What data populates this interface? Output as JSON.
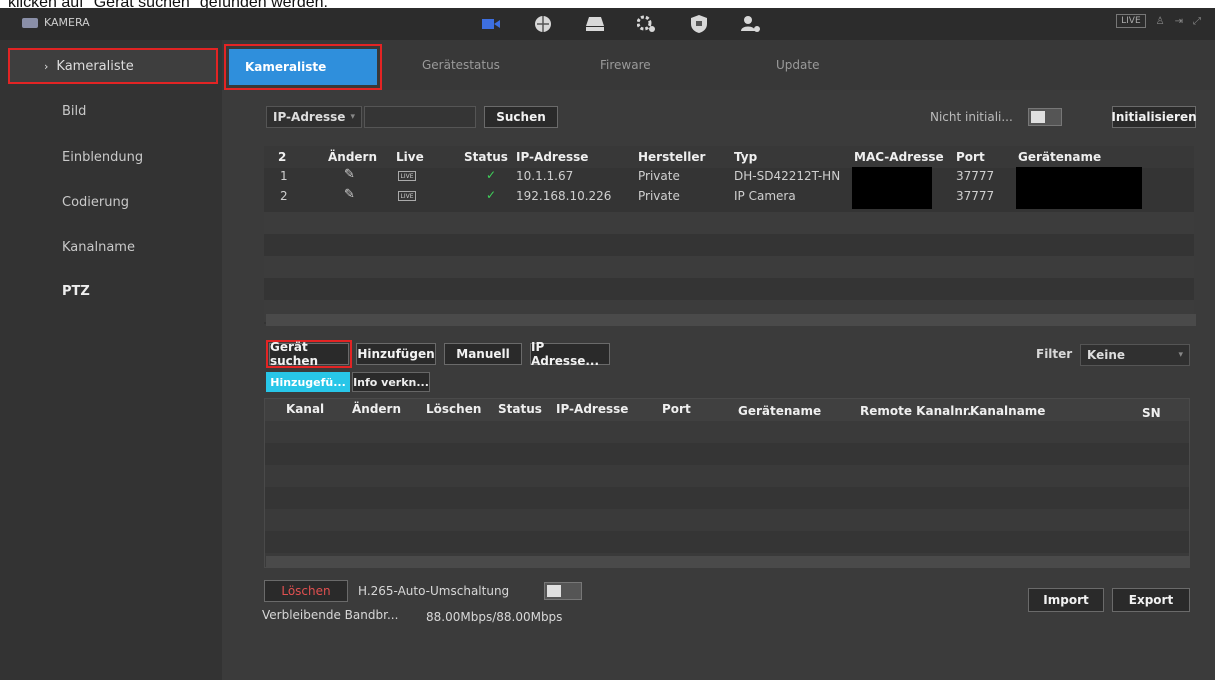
{
  "caption": "klicken auf \"Gerät suchen\" gefunden werden.",
  "app": {
    "title": "KAMERA",
    "live_tag": "LIVE",
    "top_right_icons": [
      "user-icon",
      "logout-icon",
      "fullscreen-icon"
    ]
  },
  "top_icons": [
    "camera-icon",
    "network-icon",
    "storage-icon",
    "system-settings-icon",
    "security-icon",
    "account-icon"
  ],
  "sidebar": {
    "active": "Kameraliste",
    "items": [
      "Bild",
      "Einblendung",
      "Codierung",
      "Kanalname",
      "PTZ"
    ]
  },
  "tabs": [
    "Kameraliste",
    "Gerätestatus",
    "Fireware",
    "Update"
  ],
  "search": {
    "select_value": "IP-Adresse",
    "button": "Suchen",
    "not_initialized_label": "Nicht initiali...",
    "init_button": "Initialisieren"
  },
  "device_table": {
    "headers": [
      "2",
      "Ändern",
      "Live",
      "Status",
      "IP-Adresse",
      "Hersteller",
      "Typ",
      "MAC-Adresse",
      "Port",
      "Gerätename"
    ],
    "rows": [
      {
        "no": "1",
        "live": "LIVE",
        "ip": "10.1.1.67",
        "vendor": "Private",
        "type": "DH-SD42212T-HN",
        "port": "37777"
      },
      {
        "no": "2",
        "live": "LIVE",
        "ip": "192.168.10.226",
        "vendor": "Private",
        "type": "IP Camera",
        "port": "37777"
      }
    ]
  },
  "actions": {
    "search_device": "Gerät suchen",
    "add": "Hinzufügen",
    "manual": "Manuell",
    "ip_address": "IP Adresse...",
    "filter_label": "Filter",
    "filter_value": "Keine"
  },
  "subtabs": [
    "Hinzugefü...",
    "Info verkn..."
  ],
  "added_table": {
    "headers": [
      "Kanal",
      "Ändern",
      "Löschen",
      "Status",
      "IP-Adresse",
      "Port",
      "Gerätename",
      "Remote Kanalnr.",
      "Kanalname",
      "SN"
    ]
  },
  "footer": {
    "delete": "Löschen",
    "h265_label": "H.265-Auto-Umschaltung",
    "bandwidth_label": "Verbleibende Bandbr...",
    "bandwidth_value": "88.00Mbps/88.00Mbps",
    "import": "Import",
    "export": "Export"
  },
  "colors": {
    "accent": "#2f8fdc",
    "highlight": "#e32424",
    "status_ok": "#3fcf5a",
    "subtab_active": "#28c6e8"
  }
}
